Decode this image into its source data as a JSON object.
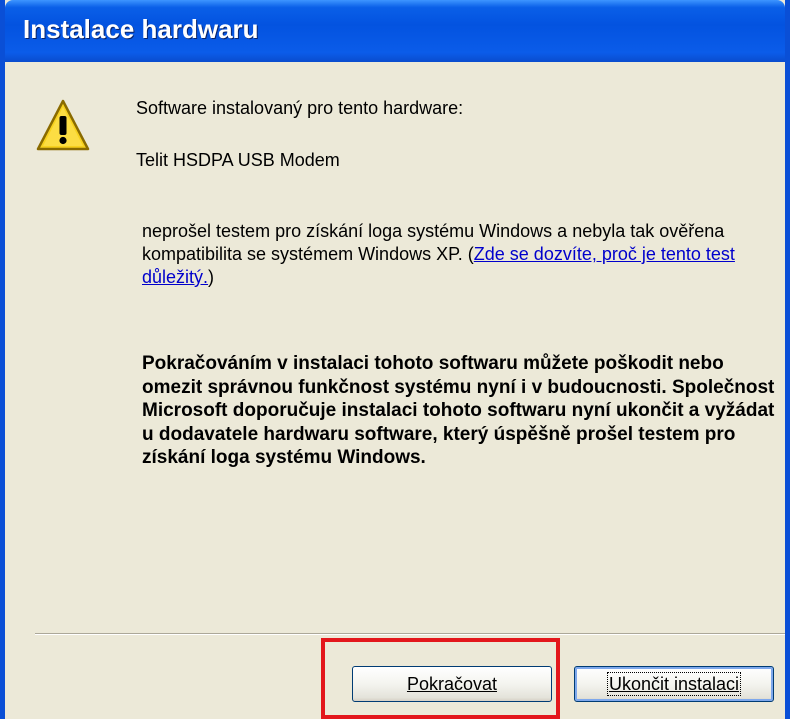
{
  "window": {
    "title": "Instalace hardwaru"
  },
  "dialog": {
    "icon": "warning-icon",
    "intro": "Software instalovaný pro tento hardware:",
    "device_name": "Telit HSDPA USB Modem",
    "notice_text": "neprošel testem pro získání loga systému Windows a nebyla tak ověřena kompatibilita se systémem Windows XP. (",
    "notice_link": "Zde se dozvíte, proč je tento test důležitý.",
    "notice_end": ")",
    "warning": "Pokračováním v instalaci tohoto softwaru můžete poškodit nebo omezit správnou funkčnost systému nyní i v budoucnosti. Společnost Microsoft doporučuje instalaci tohoto softwaru nyní ukončit a vyžádat u dodavatele hardwaru software, který úspěšně prošel testem pro získání loga systému Windows."
  },
  "buttons": {
    "continue_label": "Pokračovat",
    "cancel_label": "Ukončit instalaci"
  },
  "colors": {
    "titlebar": "#0353e0",
    "dialog_bg": "#ece9d8",
    "link": "#0000cc",
    "highlight": "#e3171c"
  }
}
